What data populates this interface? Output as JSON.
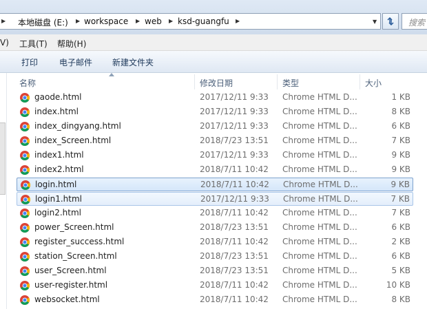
{
  "address": {
    "crumbs": [
      "本地磁盘 (E:)",
      "workspace",
      "web",
      "ksd-guangfu"
    ],
    "search_placeholder": "搜索"
  },
  "menu": [
    {
      "label": "V)"
    },
    {
      "label": "工具(T)"
    },
    {
      "label": "帮助(H)"
    }
  ],
  "commands": [
    {
      "label": "打印"
    },
    {
      "label": "电子邮件"
    },
    {
      "label": "新建文件夹"
    }
  ],
  "columns": {
    "name": "名称",
    "date": "修改日期",
    "type": "类型",
    "size": "大小"
  },
  "files": [
    {
      "name": "gaode.html",
      "date": "2017/12/11 9:33",
      "type": "Chrome HTML D...",
      "size": "1 KB",
      "state": "normal"
    },
    {
      "name": "index.html",
      "date": "2017/12/11 9:33",
      "type": "Chrome HTML D...",
      "size": "8 KB",
      "state": "normal"
    },
    {
      "name": "index_dingyang.html",
      "date": "2017/12/11 9:33",
      "type": "Chrome HTML D...",
      "size": "6 KB",
      "state": "normal"
    },
    {
      "name": "index_Screen.html",
      "date": "2018/7/23 13:51",
      "type": "Chrome HTML D...",
      "size": "7 KB",
      "state": "normal"
    },
    {
      "name": "index1.html",
      "date": "2017/12/11 9:33",
      "type": "Chrome HTML D...",
      "size": "9 KB",
      "state": "normal"
    },
    {
      "name": "index2.html",
      "date": "2018/7/11 10:42",
      "type": "Chrome HTML D...",
      "size": "9 KB",
      "state": "normal"
    },
    {
      "name": "login.html",
      "date": "2018/7/11 10:42",
      "type": "Chrome HTML D...",
      "size": "9 KB",
      "state": "selected"
    },
    {
      "name": "login1.html",
      "date": "2017/12/11 9:33",
      "type": "Chrome HTML D...",
      "size": "7 KB",
      "state": "hover"
    },
    {
      "name": "login2.html",
      "date": "2018/7/11 10:42",
      "type": "Chrome HTML D...",
      "size": "7 KB",
      "state": "normal"
    },
    {
      "name": "power_Screen.html",
      "date": "2018/7/23 13:51",
      "type": "Chrome HTML D...",
      "size": "6 KB",
      "state": "normal"
    },
    {
      "name": "register_success.html",
      "date": "2018/7/11 10:42",
      "type": "Chrome HTML D...",
      "size": "2 KB",
      "state": "normal"
    },
    {
      "name": "station_Screen.html",
      "date": "2018/7/23 13:51",
      "type": "Chrome HTML D...",
      "size": "6 KB",
      "state": "normal"
    },
    {
      "name": "user_Screen.html",
      "date": "2018/7/23 13:51",
      "type": "Chrome HTML D...",
      "size": "5 KB",
      "state": "normal"
    },
    {
      "name": "user-register.html",
      "date": "2018/7/11 10:42",
      "type": "Chrome HTML D...",
      "size": "10 KB",
      "state": "normal"
    },
    {
      "name": "websocket.html",
      "date": "2018/7/11 10:42",
      "type": "Chrome HTML D...",
      "size": "8 KB",
      "state": "normal"
    }
  ],
  "icons": {
    "file_icon": "chrome-html-file-icon",
    "refresh": "refresh-icon",
    "dropdown": "chevron-down-icon"
  }
}
